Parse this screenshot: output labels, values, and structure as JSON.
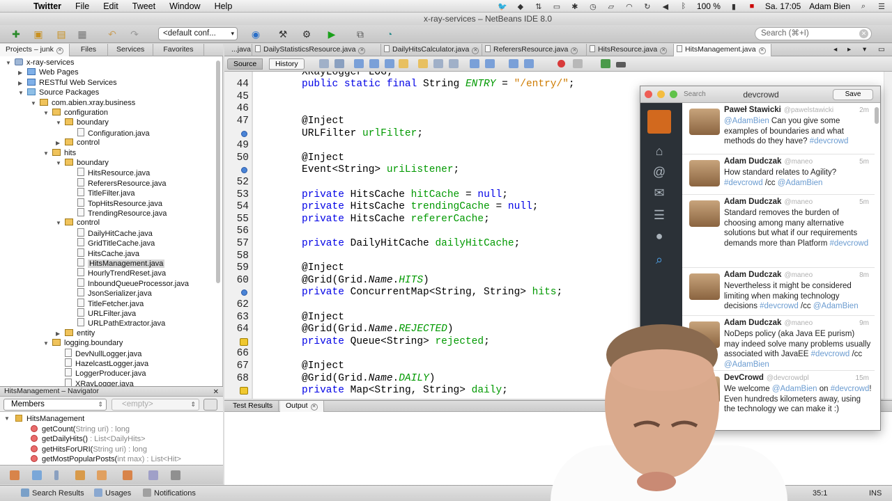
{
  "menubar": {
    "app": "Twitter",
    "items": [
      "File",
      "Edit",
      "Tweet",
      "Window",
      "Help"
    ],
    "battery": "100 %",
    "clock": "Sa. 17:05",
    "user": "Adam Bien"
  },
  "window": {
    "title": "x-ray-services – NetBeans IDE 8.0"
  },
  "toolbar": {
    "config": "<default conf...",
    "search_placeholder": "Search (⌘+I)"
  },
  "left_tabs": [
    "Projects – junk",
    "Files",
    "Services",
    "Favorites"
  ],
  "tree": [
    {
      "label": "x-ray-services",
      "indent": 0,
      "toggle": "▼",
      "icon": "proj"
    },
    {
      "label": "Web Pages",
      "indent": 1,
      "toggle": "▶",
      "icon": "web"
    },
    {
      "label": "RESTful Web Services",
      "indent": 1,
      "toggle": "▶",
      "icon": "web"
    },
    {
      "label": "Source Packages",
      "indent": 1,
      "toggle": "▼",
      "icon": "src"
    },
    {
      "label": "com.abien.xray.business",
      "indent": 2,
      "toggle": "▼",
      "icon": "pkg"
    },
    {
      "label": "configuration",
      "indent": 3,
      "toggle": "▼",
      "icon": "pkg"
    },
    {
      "label": "boundary",
      "indent": 4,
      "toggle": "▼",
      "icon": "pkg"
    },
    {
      "label": "Configuration.java",
      "indent": 5,
      "toggle": "",
      "icon": "java"
    },
    {
      "label": "control",
      "indent": 4,
      "toggle": "▶",
      "icon": "pkg"
    },
    {
      "label": "hits",
      "indent": 3,
      "toggle": "▼",
      "icon": "pkg"
    },
    {
      "label": "boundary",
      "indent": 4,
      "toggle": "▼",
      "icon": "pkg"
    },
    {
      "label": "HitsResource.java",
      "indent": 5,
      "toggle": "",
      "icon": "java"
    },
    {
      "label": "ReferersResource.java",
      "indent": 5,
      "toggle": "",
      "icon": "java"
    },
    {
      "label": "TitleFilter.java",
      "indent": 5,
      "toggle": "",
      "icon": "java"
    },
    {
      "label": "TopHitsResource.java",
      "indent": 5,
      "toggle": "",
      "icon": "java"
    },
    {
      "label": "TrendingResource.java",
      "indent": 5,
      "toggle": "",
      "icon": "java"
    },
    {
      "label": "control",
      "indent": 4,
      "toggle": "▼",
      "icon": "pkg"
    },
    {
      "label": "DailyHitCache.java",
      "indent": 5,
      "toggle": "",
      "icon": "java"
    },
    {
      "label": "GridTitleCache.java",
      "indent": 5,
      "toggle": "",
      "icon": "java"
    },
    {
      "label": "HitsCache.java",
      "indent": 5,
      "toggle": "",
      "icon": "java"
    },
    {
      "label": "HitsManagement.java",
      "indent": 5,
      "toggle": "",
      "icon": "java",
      "selected": true
    },
    {
      "label": "HourlyTrendReset.java",
      "indent": 5,
      "toggle": "",
      "icon": "java"
    },
    {
      "label": "InboundQueueProcessor.java",
      "indent": 5,
      "toggle": "",
      "icon": "java"
    },
    {
      "label": "JsonSerializer.java",
      "indent": 5,
      "toggle": "",
      "icon": "java"
    },
    {
      "label": "TitleFetcher.java",
      "indent": 5,
      "toggle": "",
      "icon": "java"
    },
    {
      "label": "URLFilter.java",
      "indent": 5,
      "toggle": "",
      "icon": "java"
    },
    {
      "label": "URLPathExtractor.java",
      "indent": 5,
      "toggle": "",
      "icon": "java"
    },
    {
      "label": "entity",
      "indent": 4,
      "toggle": "▶",
      "icon": "pkg"
    },
    {
      "label": "logging.boundary",
      "indent": 3,
      "toggle": "▼",
      "icon": "pkg"
    },
    {
      "label": "DevNullLogger.java",
      "indent": 4,
      "toggle": "",
      "icon": "java"
    },
    {
      "label": "HazelcastLogger.java",
      "indent": 4,
      "toggle": "",
      "icon": "java"
    },
    {
      "label": "LoggerProducer.java",
      "indent": 4,
      "toggle": "",
      "icon": "java"
    },
    {
      "label": "XRayLogger.java",
      "indent": 4,
      "toggle": "",
      "icon": "java"
    }
  ],
  "navigator": {
    "title": "HitsManagement – Navigator",
    "filter": "Members",
    "empty": "<empty>",
    "items": [
      {
        "name": "HitsManagement",
        "sig": "",
        "type": "class"
      },
      {
        "name": "getCount(",
        "sig": "String uri",
        "ret": ") : long"
      },
      {
        "name": "getDailyHits()",
        "sig": "",
        "ret": " : List<DailyHits>"
      },
      {
        "name": "getHitsForURI(",
        "sig": "String uri",
        "ret": ") : long"
      },
      {
        "name": "getMostPopularPosts(",
        "sig": "int max",
        "ret": ") : List<Hit>"
      }
    ]
  },
  "editor_tabs": [
    "...java",
    "DailyStatisticsResource.java",
    "DailyHitsCalculator.java",
    "ReferersResource.java",
    "HitsResource.java",
    "HitsManagement.java"
  ],
  "editor_toolbar": {
    "source": "Source",
    "history": "History"
  },
  "code": [
    {
      "n": "",
      "t": [
        [
          "",
          "XRayLogger LOG;"
        ]
      ]
    },
    {
      "n": "44",
      "t": [
        [
          "kw",
          "public static final "
        ],
        [
          "",
          "String "
        ],
        [
          "fld it",
          "ENTRY"
        ],
        [
          "",
          " = "
        ],
        [
          "str",
          "\"/entry/\""
        ],
        [
          "",
          ";"
        ]
      ]
    },
    {
      "n": "45",
      "t": []
    },
    {
      "n": "46",
      "t": []
    },
    {
      "n": "47",
      "t": [
        [
          "",
          "@Inject"
        ]
      ]
    },
    {
      "n": "",
      "mark": "blue",
      "t": [
        [
          "",
          "URLFilter "
        ],
        [
          "fld",
          "urlFilter"
        ],
        [
          "",
          ";"
        ]
      ]
    },
    {
      "n": "49",
      "t": []
    },
    {
      "n": "50",
      "t": [
        [
          "",
          "@Inject"
        ]
      ]
    },
    {
      "n": "",
      "mark": "blue",
      "t": [
        [
          "",
          "Event<String> "
        ],
        [
          "fld",
          "uriListener"
        ],
        [
          "",
          ";"
        ]
      ]
    },
    {
      "n": "52",
      "t": []
    },
    {
      "n": "53",
      "t": [
        [
          "kw",
          "private "
        ],
        [
          "",
          "HitsCache "
        ],
        [
          "fld",
          "hitCache"
        ],
        [
          "",
          " = "
        ],
        [
          "kw",
          "null"
        ],
        [
          "",
          ";"
        ]
      ]
    },
    {
      "n": "54",
      "t": [
        [
          "kw",
          "private "
        ],
        [
          "",
          "HitsCache "
        ],
        [
          "fld",
          "trendingCache"
        ],
        [
          "",
          " = "
        ],
        [
          "kw",
          "null"
        ],
        [
          "",
          ";"
        ]
      ]
    },
    {
      "n": "55",
      "t": [
        [
          "kw",
          "private "
        ],
        [
          "",
          "HitsCache "
        ],
        [
          "fld",
          "refererCache"
        ],
        [
          "",
          ";"
        ]
      ]
    },
    {
      "n": "56",
      "t": []
    },
    {
      "n": "57",
      "t": [
        [
          "kw",
          "private "
        ],
        [
          "",
          "DailyHitCache "
        ],
        [
          "fld",
          "dailyHitCache"
        ],
        [
          "",
          ";"
        ]
      ]
    },
    {
      "n": "58",
      "t": []
    },
    {
      "n": "59",
      "t": [
        [
          "",
          "@Inject"
        ]
      ]
    },
    {
      "n": "60",
      "t": [
        [
          "",
          "@Grid(Grid."
        ],
        [
          "it",
          "Name"
        ],
        [
          "",
          "."
        ],
        [
          "fld it",
          "HITS"
        ],
        [
          "",
          ")"
        ]
      ]
    },
    {
      "n": "",
      "mark": "blue",
      "t": [
        [
          "kw",
          "private "
        ],
        [
          "",
          "ConcurrentMap<String, String> "
        ],
        [
          "fld",
          "hits"
        ],
        [
          "",
          ";"
        ]
      ]
    },
    {
      "n": "62",
      "t": []
    },
    {
      "n": "63",
      "t": [
        [
          "",
          "@Inject"
        ]
      ]
    },
    {
      "n": "64",
      "t": [
        [
          "",
          "@Grid(Grid."
        ],
        [
          "it",
          "Name"
        ],
        [
          "",
          "."
        ],
        [
          "fld it",
          "REJECTED"
        ],
        [
          "",
          ")"
        ]
      ]
    },
    {
      "n": "",
      "mark": "warn",
      "t": [
        [
          "kw",
          "private "
        ],
        [
          "",
          "Queue<String> "
        ],
        [
          "fld",
          "rejected"
        ],
        [
          "",
          ";"
        ]
      ]
    },
    {
      "n": "66",
      "t": []
    },
    {
      "n": "67",
      "t": [
        [
          "",
          "@Inject"
        ]
      ]
    },
    {
      "n": "68",
      "t": [
        [
          "",
          "@Grid(Grid."
        ],
        [
          "it",
          "Name"
        ],
        [
          "",
          "."
        ],
        [
          "fld it",
          "DAILY"
        ],
        [
          "",
          ")"
        ]
      ]
    },
    {
      "n": "",
      "mark": "warn",
      "t": [
        [
          "kw",
          "private "
        ],
        [
          "",
          "Map<String, String> "
        ],
        [
          "fld",
          "daily"
        ],
        [
          "",
          ";"
        ]
      ]
    }
  ],
  "output_tabs": [
    "Test Results",
    "Output"
  ],
  "status": {
    "search": "Search Results",
    "usages": "Usages",
    "notifications": "Notifications",
    "position": "35:1",
    "mode": "INS"
  },
  "twitter": {
    "search": "Search",
    "account": "devcrowd",
    "save": "Save",
    "tweets": [
      {
        "name": "Paweł Stawicki",
        "handle": "@pawelstawicki",
        "time": "2m",
        "body": [
          [
            "h",
            "@AdamBien"
          ],
          [
            "",
            " Can you give some examples of boundaries and what methods do they have? "
          ],
          [
            "h",
            "#devcrowd"
          ]
        ]
      },
      {
        "name": "Adam Dudczak",
        "handle": "@maneo",
        "time": "5m",
        "body": [
          [
            "",
            "How standard relates to Agility? "
          ],
          [
            "h",
            "#devcrowd"
          ],
          [
            "",
            " /cc "
          ],
          [
            "h",
            "@AdamBien"
          ]
        ]
      },
      {
        "name": "Adam Dudczak",
        "handle": "@maneo",
        "time": "5m",
        "body": [
          [
            "",
            "Standard removes the burden of choosing among many alternative solutions but what if our requirements demands more than Platform "
          ],
          [
            "h",
            "#devcrowd"
          ]
        ]
      },
      {
        "name": "Adam Dudczak",
        "handle": "@maneo",
        "time": "8m",
        "body": [
          [
            "",
            "Nevertheless it might be considered limiting when making technology decisions "
          ],
          [
            "h",
            "#devcrowd"
          ],
          [
            "",
            " /cc "
          ],
          [
            "h",
            "@AdamBien"
          ]
        ]
      },
      {
        "name": "Adam Dudczak",
        "handle": "@maneo",
        "time": "9m",
        "body": [
          [
            "",
            "NoDeps policy (aka Java EE purism) may indeed solve many problems usually associated with JavaEE "
          ],
          [
            "h",
            "#devcrowd"
          ],
          [
            "",
            " /cc "
          ],
          [
            "h",
            "@AdamBien"
          ]
        ]
      },
      {
        "name": "DevCrowd",
        "handle": "@devcrowdpl",
        "time": "15m",
        "body": [
          [
            "",
            "We welcome "
          ],
          [
            "h",
            "@AdamBien"
          ],
          [
            "",
            " on "
          ],
          [
            "h",
            "#devcrowd"
          ],
          [
            "",
            "! Even hundreds kilometers away, using the technology we can make it :)"
          ]
        ]
      }
    ]
  }
}
